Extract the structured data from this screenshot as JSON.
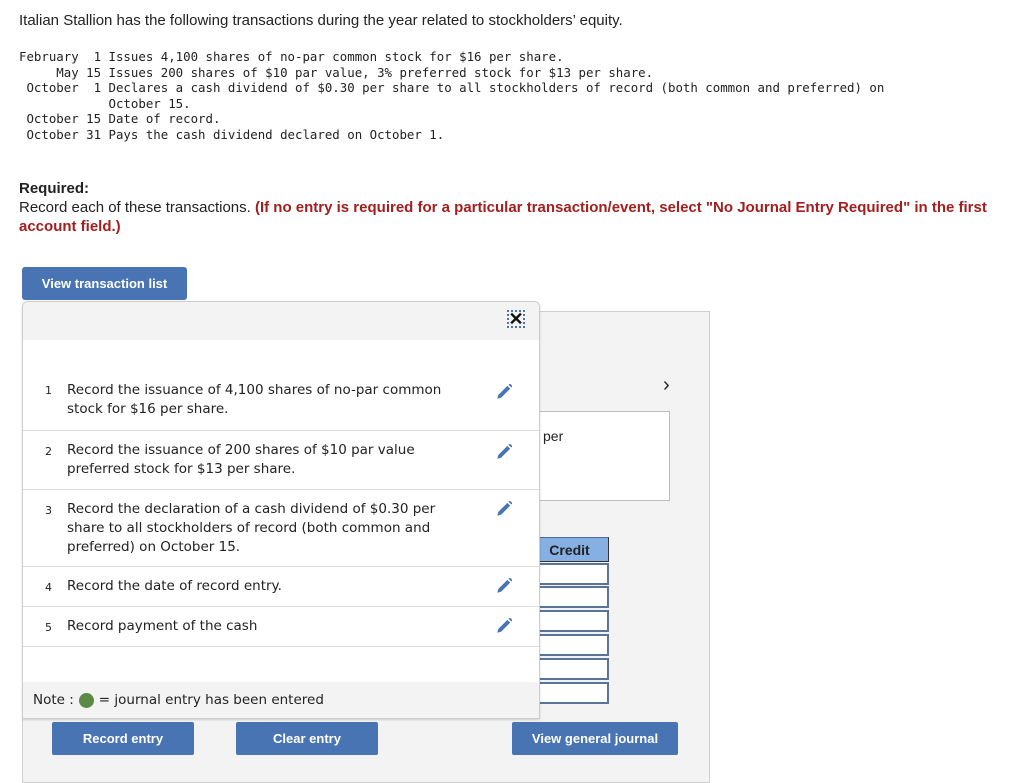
{
  "intro": "Italian Stallion has the following transactions during the year related to stockholders’ equity.",
  "transactions_text": [
    "February  1 Issues 4,100 shares of no-par common stock for $16 per share.",
    "     May 15 Issues 200 shares of $10 par value, 3% preferred stock for $13 per share.",
    " October  1 Declares a cash dividend of $0.30 per share to all stockholders of record (both common and preferred) on",
    "            October 15.",
    " October 15 Date of record.",
    " October 31 Pays the cash dividend declared on October 1."
  ],
  "required": {
    "title": "Required:",
    "text": "Record each of these transactions. ",
    "instruction": "(If no entry is required for a particular transaction/event, select \"No Journal Entry Required\" in the first account field.)"
  },
  "buttons": {
    "view_transaction_list": "View transaction list",
    "record_entry": "Record entry",
    "clear_entry": "Clear entry",
    "view_general_journal": "View general journal"
  },
  "popup": {
    "close_icon": "✕",
    "items": [
      {
        "num": "1",
        "text": "Record the issuance of 4,100 shares of no-par common stock for $16 per share."
      },
      {
        "num": "2",
        "text": "Record the issuance of 200 shares of $10 par value preferred stock for $13 per share."
      },
      {
        "num": "3",
        "text": "Record the declaration of a cash dividend of $0.30 per share to all stockholders of record (both common and preferred) on October 15."
      },
      {
        "num": "4",
        "text": "Record the date of record entry."
      },
      {
        "num": "5",
        "text": "Record payment of the cash"
      }
    ],
    "note_prefix": "Note :",
    "note_suffix": "= journal entry has been entered"
  },
  "journal": {
    "chevron": "›",
    "description_fragment": "per",
    "credit_header": "Credit",
    "credit_values": [
      "",
      "",
      "",
      "",
      "",
      ""
    ]
  },
  "colors": {
    "button_blue": "#4874b4",
    "instruction_red": "#a41e1e",
    "entered_dot_green": "#5b8a47",
    "credit_header_bg": "#86afe3"
  }
}
